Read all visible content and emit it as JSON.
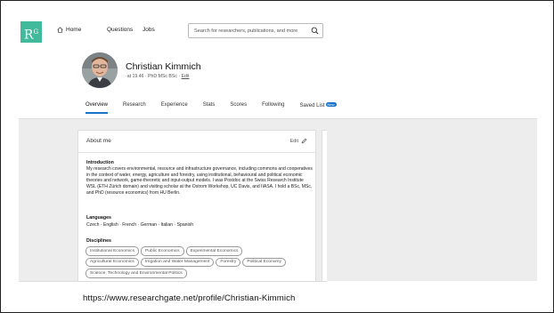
{
  "nav": {
    "logo_text": "R",
    "logo_sup": "G",
    "home_label": "Home",
    "questions_label": "Questions",
    "jobs_label": "Jobs",
    "search_placeholder": "Search for researchers, publications, and more"
  },
  "profile": {
    "name": "Christian Kimmich",
    "meta_text": "·at 19.46 · PhD MSc BSc · ",
    "edit_link": "Edit"
  },
  "tabs": [
    {
      "label": "Overview",
      "active": true
    },
    {
      "label": "Research"
    },
    {
      "label": "Experience"
    },
    {
      "label": "Stats"
    },
    {
      "label": "Scores"
    },
    {
      "label": "Following"
    },
    {
      "label": "Saved List",
      "badge": "New"
    }
  ],
  "about": {
    "title": "About me",
    "edit_label": "Edit",
    "introduction_heading": "Introduction",
    "introduction_text": "My research covers environmental, resource and infrastructure governance, including commons and cooperatives in the context of water, energy, agriculture and forestry, using institutional, behavioural and political economic theories and network, game-theoretic and input-output models. I was Postdoc at the Swiss Research Institute WSL (ETH Zürich domain) and visiting scholar at the Ostrom Workshop, UC Davis, and IIASA. I hold a BSc, MSc, and PhD (resource economics) from HU Berlin.",
    "languages_heading": "Languages",
    "languages_text": "Czech · English · French · German · Italian · Spanish",
    "disciplines_heading": "Disciplines",
    "disciplines": [
      [
        "Institutional Economics",
        "Public Economics",
        "Experimental Economics"
      ],
      [
        "Agricultural Economics",
        "Irrigation and Water Management",
        "Forestry",
        "Political Economy"
      ],
      [
        "Science, Technology and Environmental Politics"
      ]
    ]
  },
  "caption": {
    "url": "https://www.researchgate.net/profile/Christian-Kimmich"
  },
  "colors": {
    "brand": "#40ba9b",
    "accent": "#1a73c9"
  },
  "icons": {
    "home": "home-icon",
    "search": "search-icon",
    "edit": "pencil-icon"
  }
}
